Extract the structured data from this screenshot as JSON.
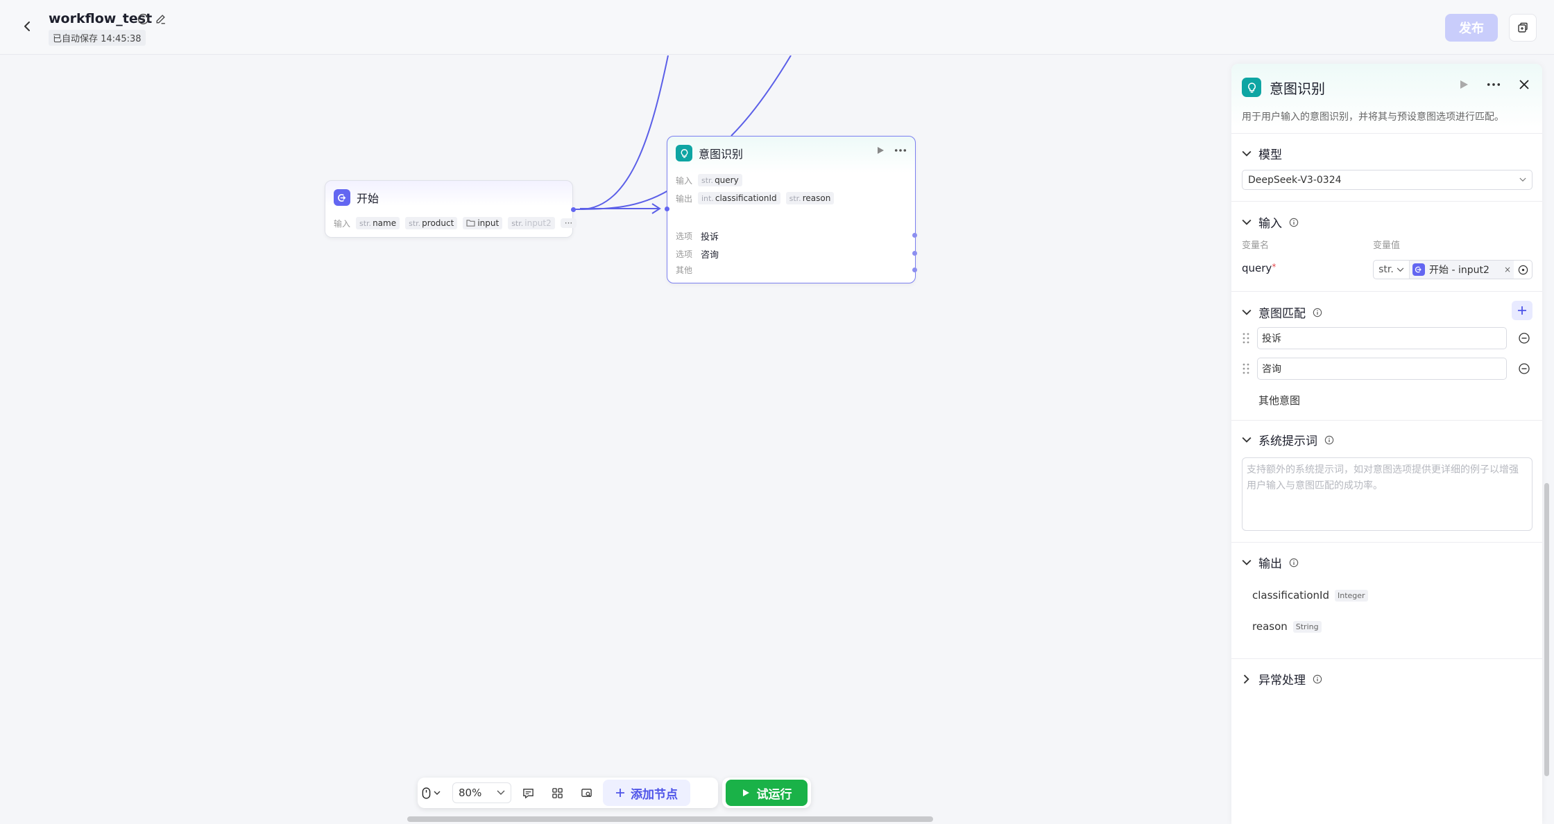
{
  "header": {
    "title": "workflow_test",
    "saved": "已自动保存 14:45:38",
    "publish": "发布"
  },
  "nodes": {
    "start": {
      "title": "开始",
      "input_label": "输入",
      "inputs": [
        {
          "type": "str.",
          "name": "name"
        },
        {
          "type": "str.",
          "name": "product"
        },
        {
          "type": "",
          "name": "input"
        },
        {
          "type": "str.",
          "name": "input2"
        }
      ],
      "more": "···"
    },
    "intent": {
      "title": "意图识别",
      "input_label": "输入",
      "input_type": "str.",
      "input_name": "query",
      "output_label": "输出",
      "outputs": [
        {
          "type": "int.",
          "name": "classificationId"
        },
        {
          "type": "str.",
          "name": "reason"
        }
      ],
      "option_label": "选项",
      "options": [
        "投诉",
        "咨询"
      ],
      "other_label": "其他"
    }
  },
  "toolbar": {
    "zoom": "80%",
    "add_node": "添加节点",
    "run": "试运行"
  },
  "panel": {
    "title": "意图识别",
    "description": "用于用户输入的意图识别，并将其与预设意图选项进行匹配。",
    "model": {
      "label": "模型",
      "value": "DeepSeek-V3-0324"
    },
    "input": {
      "label": "输入",
      "col_name": "变量名",
      "col_value": "变量值",
      "var_name": "query",
      "required_mark": "*",
      "type": "str.",
      "ref": "开始 - input2",
      "clear": "×"
    },
    "intents": {
      "label": "意图匹配",
      "items": [
        "投诉",
        "咨询"
      ],
      "other": "其他意图"
    },
    "system_prompt": {
      "label": "系统提示词",
      "placeholder": "支持额外的系统提示词，如对意图选项提供更详细的例子以增强用户输入与意图匹配的成功率。"
    },
    "output": {
      "label": "输出",
      "items": [
        {
          "name": "classificationId",
          "type": "Integer"
        },
        {
          "name": "reason",
          "type": "String"
        }
      ]
    },
    "exception": {
      "label": "异常处理"
    }
  },
  "colors": {
    "accent": "#4d53e8",
    "start_icon": "#6366f1",
    "intent_icon": "#0ea5a3",
    "run_green": "#1ab248",
    "publish_disabled": "#c9cdfb"
  }
}
